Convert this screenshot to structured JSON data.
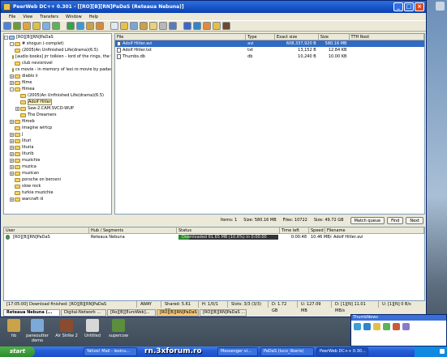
{
  "window": {
    "title": "PeerWeb DC++ 0.301 - [[RO][B][RN]PaDaS (Reteaua Nebuna)]",
    "menu": [
      "File",
      "View",
      "Transfers",
      "Window",
      "Help"
    ]
  },
  "tree": {
    "root": "[RO][B][RN]PaDaS",
    "items": [
      {
        "label": "# shogun (-complet)",
        "exp": "-",
        "indent": 1
      },
      {
        "label": "(2005)An Unfinished Life(drama)(6.5)",
        "exp": "",
        "indent": 1
      },
      {
        "label": "[audio books] jrr tolkien - lord of the rings, the fel",
        "exp": "",
        "indent": 1
      },
      {
        "label": "club nevisrovel",
        "exp": "",
        "indent": 1
      },
      {
        "label": "cs movie - in memory of lexi.ro movie by padas",
        "exp": "",
        "indent": 1
      },
      {
        "label": "diablo ii",
        "exp": "+",
        "indent": 1
      },
      {
        "label": "filme",
        "exp": "+",
        "indent": 1
      },
      {
        "label": "filmea",
        "exp": "-",
        "indent": 1
      },
      {
        "label": "(2005)An Unfinished Life(drama)(6.5)",
        "exp": "",
        "indent": 2
      },
      {
        "label": "Adolf Hitler",
        "exp": "",
        "indent": 2,
        "selected": true
      },
      {
        "label": "Saw-2.CAM.SVCD-WUP",
        "exp": "+",
        "indent": 2
      },
      {
        "label": "The Dreamers",
        "exp": "",
        "indent": 2
      },
      {
        "label": "filmeb",
        "exp": "+",
        "indent": 1
      },
      {
        "label": "imagine wirtcp",
        "exp": "",
        "indent": 1
      },
      {
        "label": "j",
        "exp": "+",
        "indent": 1
      },
      {
        "label": "lituri",
        "exp": "+",
        "indent": 1
      },
      {
        "label": "lituria",
        "exp": "+",
        "indent": 1
      },
      {
        "label": "liturib",
        "exp": "+",
        "indent": 1
      },
      {
        "label": "muzichie",
        "exp": "+",
        "indent": 1
      },
      {
        "label": "muzica",
        "exp": "+",
        "indent": 1
      },
      {
        "label": "muzican",
        "exp": "+",
        "indent": 1
      },
      {
        "label": "porsche on berceni",
        "exp": "",
        "indent": 1
      },
      {
        "label": "slow rock",
        "exp": "",
        "indent": 1
      },
      {
        "label": "turkie muzichie",
        "exp": "",
        "indent": 1
      },
      {
        "label": "warcraft iii",
        "exp": "+",
        "indent": 1
      }
    ]
  },
  "files": {
    "columns": [
      "File",
      "Type",
      "Exact size",
      "Size",
      "TTH Root"
    ],
    "rows": [
      {
        "name": "Adolf Hitler.avi",
        "type": "avi",
        "exact": "608,337,920 B",
        "size": "580.16 MB",
        "tth": "",
        "selected": true
      },
      {
        "name": "Adolf Hitler.txt",
        "type": "txt",
        "exact": "13,152 B",
        "size": "12.84 KB",
        "tth": ""
      },
      {
        "name": "Thumbs.db",
        "type": "db",
        "exact": "10,240 B",
        "size": "10.00 KB",
        "tth": ""
      }
    ]
  },
  "status": {
    "items": "Items: 1",
    "size": "Size: 580.16 MB",
    "files": "Files: 10722",
    "total": "Size: 49.72 GB",
    "match_queue": "Match queue",
    "find": "Find",
    "next": "Next"
  },
  "transfers": {
    "columns": [
      "User",
      "Hub / Segments",
      "Status",
      "Time left",
      "Speed",
      "Filename"
    ],
    "rows": [
      {
        "user": "[RO][B][RN]PaDaS",
        "hub": "Reteaua Nebuna",
        "status": "Downloaded 61.65 MB (10.6%) in 0:00:00",
        "time": "0:00:48",
        "speed": "10.46 MB/s",
        "file": "Adolf Hitler.avi"
      }
    ]
  },
  "log": {
    "message": "[17:05:00] Download finished: [RO][B][RN]PaDaS",
    "away": "AWAY",
    "shared": "Shared: 5.61 GB",
    "hubs": "H: 1/0/1",
    "slots": "Slots: 3/3 (3/3)",
    "d": "D: 1.72 GB",
    "u": "U: 127.09 MB",
    "dspeed": "D: [1][N] 11.01 MB/s",
    "uspeed": "U: [1][N] 0 B/s"
  },
  "tabs": [
    {
      "label": "Reteaua Nebuna (...",
      "state": "active"
    },
    {
      "label": "Digital-Network ...",
      "state": ""
    },
    {
      "label": "[Ro][B][EuroWeb]...",
      "state": ""
    },
    {
      "label": "[RO][B][RN]PaDaS",
      "state": "orange"
    },
    {
      "label": "[RO][B][RN]PaDaS ...",
      "state": ""
    }
  ],
  "desktop_icons": [
    {
      "label": "hb",
      "color": "#c9a24a"
    },
    {
      "label": "paneoutter demo",
      "color": "#7ca9d8"
    },
    {
      "label": "Air Strike 2",
      "color": "#8a4b2e"
    },
    {
      "label": "Untitled",
      "color": "#d8d8d8"
    },
    {
      "label": "supercow",
      "color": "#5b8e3d"
    }
  ],
  "mini_window": {
    "title": "ThumbNews"
  },
  "taskbar": {
    "start": "start",
    "tasks": [
      "Yahoo! Mail - lexinu...",
      "Messenger vi...",
      "PeDaS (luco_liberis)",
      "PeerWeb DC++ 0.30..."
    ],
    "watermark": "rn.3xforum.ro"
  }
}
